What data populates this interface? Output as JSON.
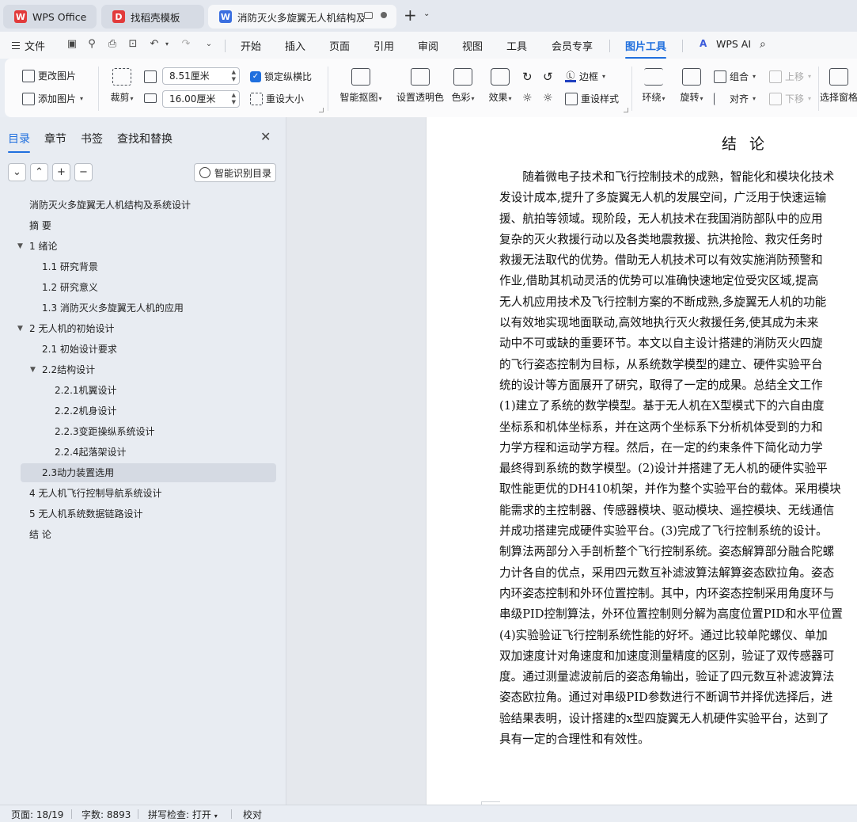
{
  "tabs": [
    {
      "label": "WPS Office",
      "logo": "W",
      "color": "#e23b3b"
    },
    {
      "label": "找稻壳模板",
      "logo": "D",
      "color": "#e23b3b"
    },
    {
      "label": "消防灭火多旋翼无人机结构及系",
      "logo": "W",
      "color": "#3b6fe0"
    }
  ],
  "menu": {
    "file": "文件",
    "items": [
      "开始",
      "插入",
      "页面",
      "引用",
      "审阅",
      "视图",
      "工具",
      "会员专享",
      "图片工具"
    ],
    "ai": "WPS AI"
  },
  "ribbon": {
    "change_picture": "更改图片",
    "add_picture": "添加图片",
    "crop": "裁剪",
    "width_value": "8.51厘米",
    "height_value": "16.00厘米",
    "lock_ratio": "锁定纵横比",
    "resize": "重设大小",
    "smart_cutout": "智能抠图",
    "set_transparent": "设置透明色",
    "color": "色彩",
    "effects": "效果",
    "border": "边框",
    "reset_style": "重设样式",
    "wrap": "环绕",
    "rotate": "旋转",
    "group": "组合",
    "align": "对齐",
    "move_up": "上移",
    "move_down": "下移",
    "selection_pane": "选择窗格"
  },
  "nav": {
    "tabs": [
      "目录",
      "章节",
      "书签",
      "查找和替换"
    ],
    "ai_toc": "智能识别目录",
    "toc": [
      {
        "label": "消防灭火多旋翼无人机结构及系统设计",
        "level": 0
      },
      {
        "label": "摘 要",
        "level": 0
      },
      {
        "label": "1 绪论",
        "level": 0,
        "expanded": true
      },
      {
        "label": "1.1 研究背景",
        "level": 1
      },
      {
        "label": "1.2 研究意义",
        "level": 1
      },
      {
        "label": "1.3 消防灭火多旋翼无人机的应用",
        "level": 1
      },
      {
        "label": "2 无人机的初始设计",
        "level": 0,
        "expanded": true
      },
      {
        "label": "2.1 初始设计要求",
        "level": 1
      },
      {
        "label": "2.2结构设计",
        "level": 1,
        "expanded": true
      },
      {
        "label": "2.2.1机翼设计",
        "level": 2
      },
      {
        "label": "2.2.2机身设计",
        "level": 2
      },
      {
        "label": "2.2.3变距操纵系统设计",
        "level": 2
      },
      {
        "label": "2.2.4起落架设计",
        "level": 2
      },
      {
        "label": "2.3动力装置选用",
        "level": 1,
        "selected": true
      },
      {
        "label": "4 无人机飞行控制导航系统设计",
        "level": 0
      },
      {
        "label": "5 无人机系统数据链路设计",
        "level": 0
      },
      {
        "label": "结 论",
        "level": 0
      }
    ]
  },
  "document": {
    "title": "结 论",
    "lines": [
      "　　随着微电子技术和飞行控制技术的成熟，智能化和模块化技术",
      "发设计成本,提升了多旋翼无人机的发展空间，广泛用于快速运输",
      "援、航拍等领域。现阶段，无人机技术在我国消防部队中的应用",
      "复杂的灭火救援行动以及各类地震救援、抗洪抢险、救灾任务时",
      "救援无法取代的优势。借助无人机技术可以有效实施消防预警和",
      "作业,借助其机动灵活的优势可以准确快速地定位受灾区域,提高",
      "无人机应用技术及飞行控制方案的不断成熟,多旋翼无人机的功能",
      "以有效地实现地面联动,高效地执行灭火救援任务,使其成为未来",
      "动中不可或缺的重要环节。本文以自主设计搭建的消防灭火四旋",
      "的飞行姿态控制为目标，从系统数学模型的建立、硬件实验平台",
      "统的设计等方面展开了研究，取得了一定的成果。总结全文工作",
      "(1)建立了系统的数学模型。基于无人机在X型模式下的六自由度",
      "坐标系和机体坐标系，并在这两个坐标系下分析机体受到的力和",
      "力学方程和运动学方程。然后，在一定的约束条件下简化动力学",
      "最终得到系统的数学模型。(2)设计并搭建了无人机的硬件实验平",
      "取性能更优的DH410机架，并作为整个实验平台的载体。采用模块",
      "能需求的主控制器、传感器模块、驱动模块、遥控模块、无线通信",
      "并成功搭建完成硬件实验平台。(3)完成了飞行控制系统的设计。",
      "制算法两部分入手剖析整个飞行控制系统。姿态解算部分融合陀螺",
      "力计各自的优点，采用四元数互补滤波算法解算姿态欧拉角。姿态",
      "内环姿态控制和外环位置控制。其中，内环姿态控制采用角度环与",
      "串级PID控制算法，外环位置控制则分解为高度位置PID和水平位置",
      "(4)实验验证飞行控制系统性能的好坏。通过比较单陀螺仪、单加",
      "双加速度计对角速度和加速度测量精度的区别，验证了双传感器可",
      "度。通过测量滤波前后的姿态角输出，验证了四元数互补滤波算法",
      "姿态欧拉角。通过对串级PID参数进行不断调节并择优选择后，进",
      "验结果表明，设计搭建的x型四旋翼无人机硬件实验平台，达到了",
      "具有一定的合理性和有效性。"
    ]
  },
  "status": {
    "page": "页面: 18/19",
    "words": "字数: 8893",
    "spell": "拼写检查: 打开",
    "proof": "校对"
  },
  "colors": {
    "accent": "#1f6fde",
    "wps_red": "#e23b3b"
  }
}
